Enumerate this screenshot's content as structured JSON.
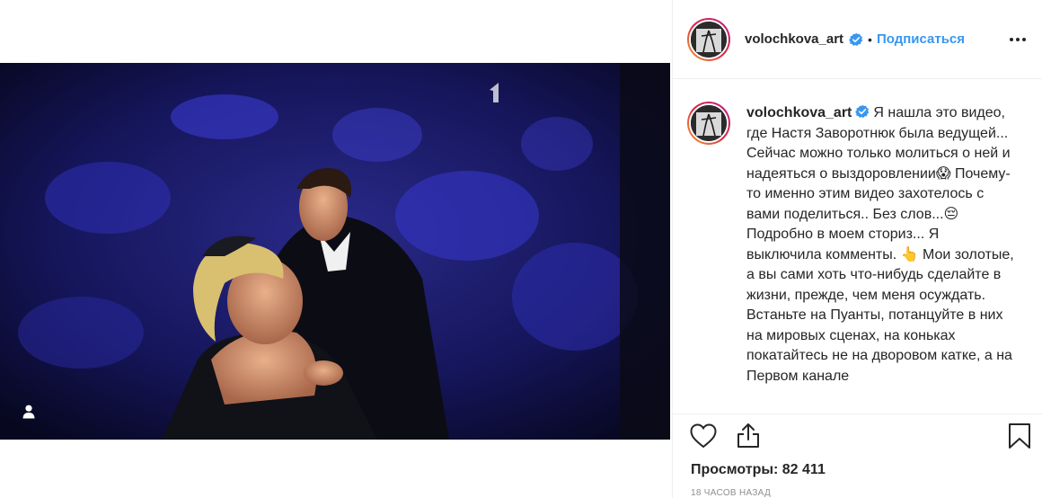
{
  "post": {
    "username": "volochkova_art",
    "follow_label": "Подписаться",
    "separator": "•",
    "caption_part1": "Я нашла это видео, где Настя Заворотнюк была ведущей... Сейчас можно только молиться о ней и надеяться о выздоровлении😱 Почему-то именно этим видео захотелось с вами поделиться.. Без слов...😔 Подробно в моем сториз... Я выключила комменты. 👆 Мои золотые, а вы сами хоть что-нибудь сделайте в жизни, прежде, чем меня осуждать. Встаньте на Пуанты, потанцуйте в них на мировых сценах, на коньках покатайтесь не на дворовом катке, а на Первом канале",
    "views_text": "Просмотры: 82 411",
    "timestamp": "18 часов назад"
  },
  "icons": {
    "tag": "user-tag-icon",
    "verified": "verified-badge-icon",
    "more": "more-options-icon",
    "like": "heart-icon",
    "share": "share-icon",
    "save": "bookmark-icon"
  },
  "colors": {
    "accent": "#3897f0",
    "text": "#262626",
    "muted": "#8e8e8e",
    "border": "#efefef",
    "verified": "#3897f0"
  }
}
